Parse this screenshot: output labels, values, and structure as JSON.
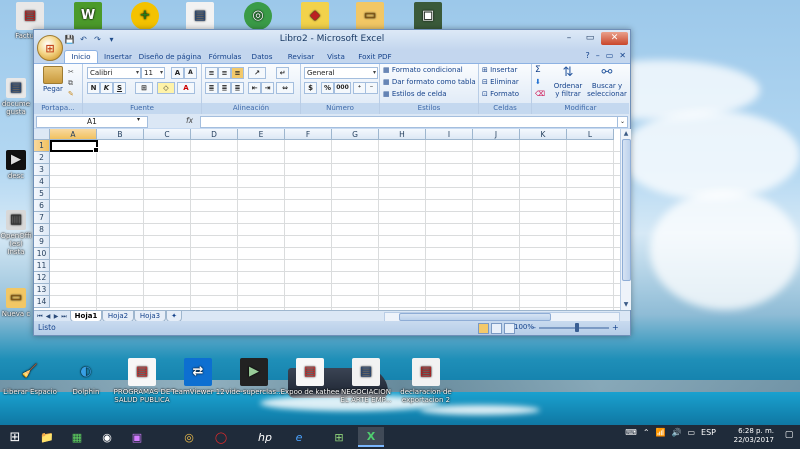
{
  "window": {
    "title": "Libro2 - Microsoft Excel",
    "minimize": "–",
    "restore": "▭",
    "close": "✕"
  },
  "qat": [
    "💾",
    "↶",
    "↷",
    "▾"
  ],
  "tabs": [
    "Inicio",
    "Insertar",
    "Diseño de página",
    "Fórmulas",
    "Datos",
    "Revisar",
    "Vista",
    "Foxit PDF"
  ],
  "ribbon": {
    "clipboard": {
      "title": "Portapa...",
      "paste": "Pegar"
    },
    "font": {
      "title": "Fuente",
      "name": "Calibri",
      "size": "11",
      "grow": "A",
      "shrink": "A",
      "bold": "N",
      "italic": "K",
      "underline": "S",
      "color_letter": "A"
    },
    "alignment": {
      "title": "Alineación"
    },
    "number": {
      "title": "Número",
      "format": "General",
      "currency": "$",
      "percent": "%",
      "comma": "000"
    },
    "styles": {
      "title": "Estilos",
      "conditional": "Formato condicional",
      "table": "Dar formato como tabla",
      "cell": "Estilos de celda"
    },
    "cells": {
      "title": "Celdas",
      "insert": "Insertar",
      "delete": "Eliminar",
      "format": "Formato"
    },
    "editing": {
      "title": "Modificar",
      "sigma": "Σ",
      "sort": "Ordenar",
      "sort2": "y filtrar",
      "find": "Buscar y",
      "find2": "seleccionar"
    }
  },
  "formula_bar": {
    "name_box": "A1",
    "fx": "fx",
    "value": ""
  },
  "columns": [
    "A",
    "B",
    "C",
    "D",
    "E",
    "F",
    "G",
    "H",
    "I",
    "J",
    "K",
    "L"
  ],
  "rows": [
    "1",
    "2",
    "3",
    "4",
    "5",
    "6",
    "7",
    "8",
    "9",
    "10",
    "11",
    "12",
    "13",
    "14"
  ],
  "sheets": [
    "Hoja1",
    "Hoja2",
    "Hoja3"
  ],
  "status": {
    "text": "Listo",
    "zoom": "100%",
    "minus": "–",
    "plus": "+"
  },
  "desktop": {
    "top_icons": [
      "Facturas",
      "",
      "",
      "",
      "",
      "",
      "",
      ""
    ],
    "left_icons": [
      "docume gusta",
      "desc",
      "OpenOffi (es) Insta",
      "Nueva c"
    ],
    "bottom_icons": [
      "Liberar Espacio",
      "Dolphin",
      "PROGRAMAS DE SALUD PUBLICA",
      "TeamViewer 12",
      "vide-superclas...",
      "Expoo de kathee",
      "NEGOCIACION EL ARTE EMP...",
      "declaracion de exportacion 2"
    ]
  },
  "taskbar": {
    "start": "⊞",
    "apps": [
      "📁",
      "▦",
      "◉",
      "▣",
      "◎",
      "◯",
      "hp",
      "e",
      "⊞",
      "X"
    ],
    "lang": "ESP",
    "time": "6:28 p. m.",
    "date": "22/03/2017"
  }
}
